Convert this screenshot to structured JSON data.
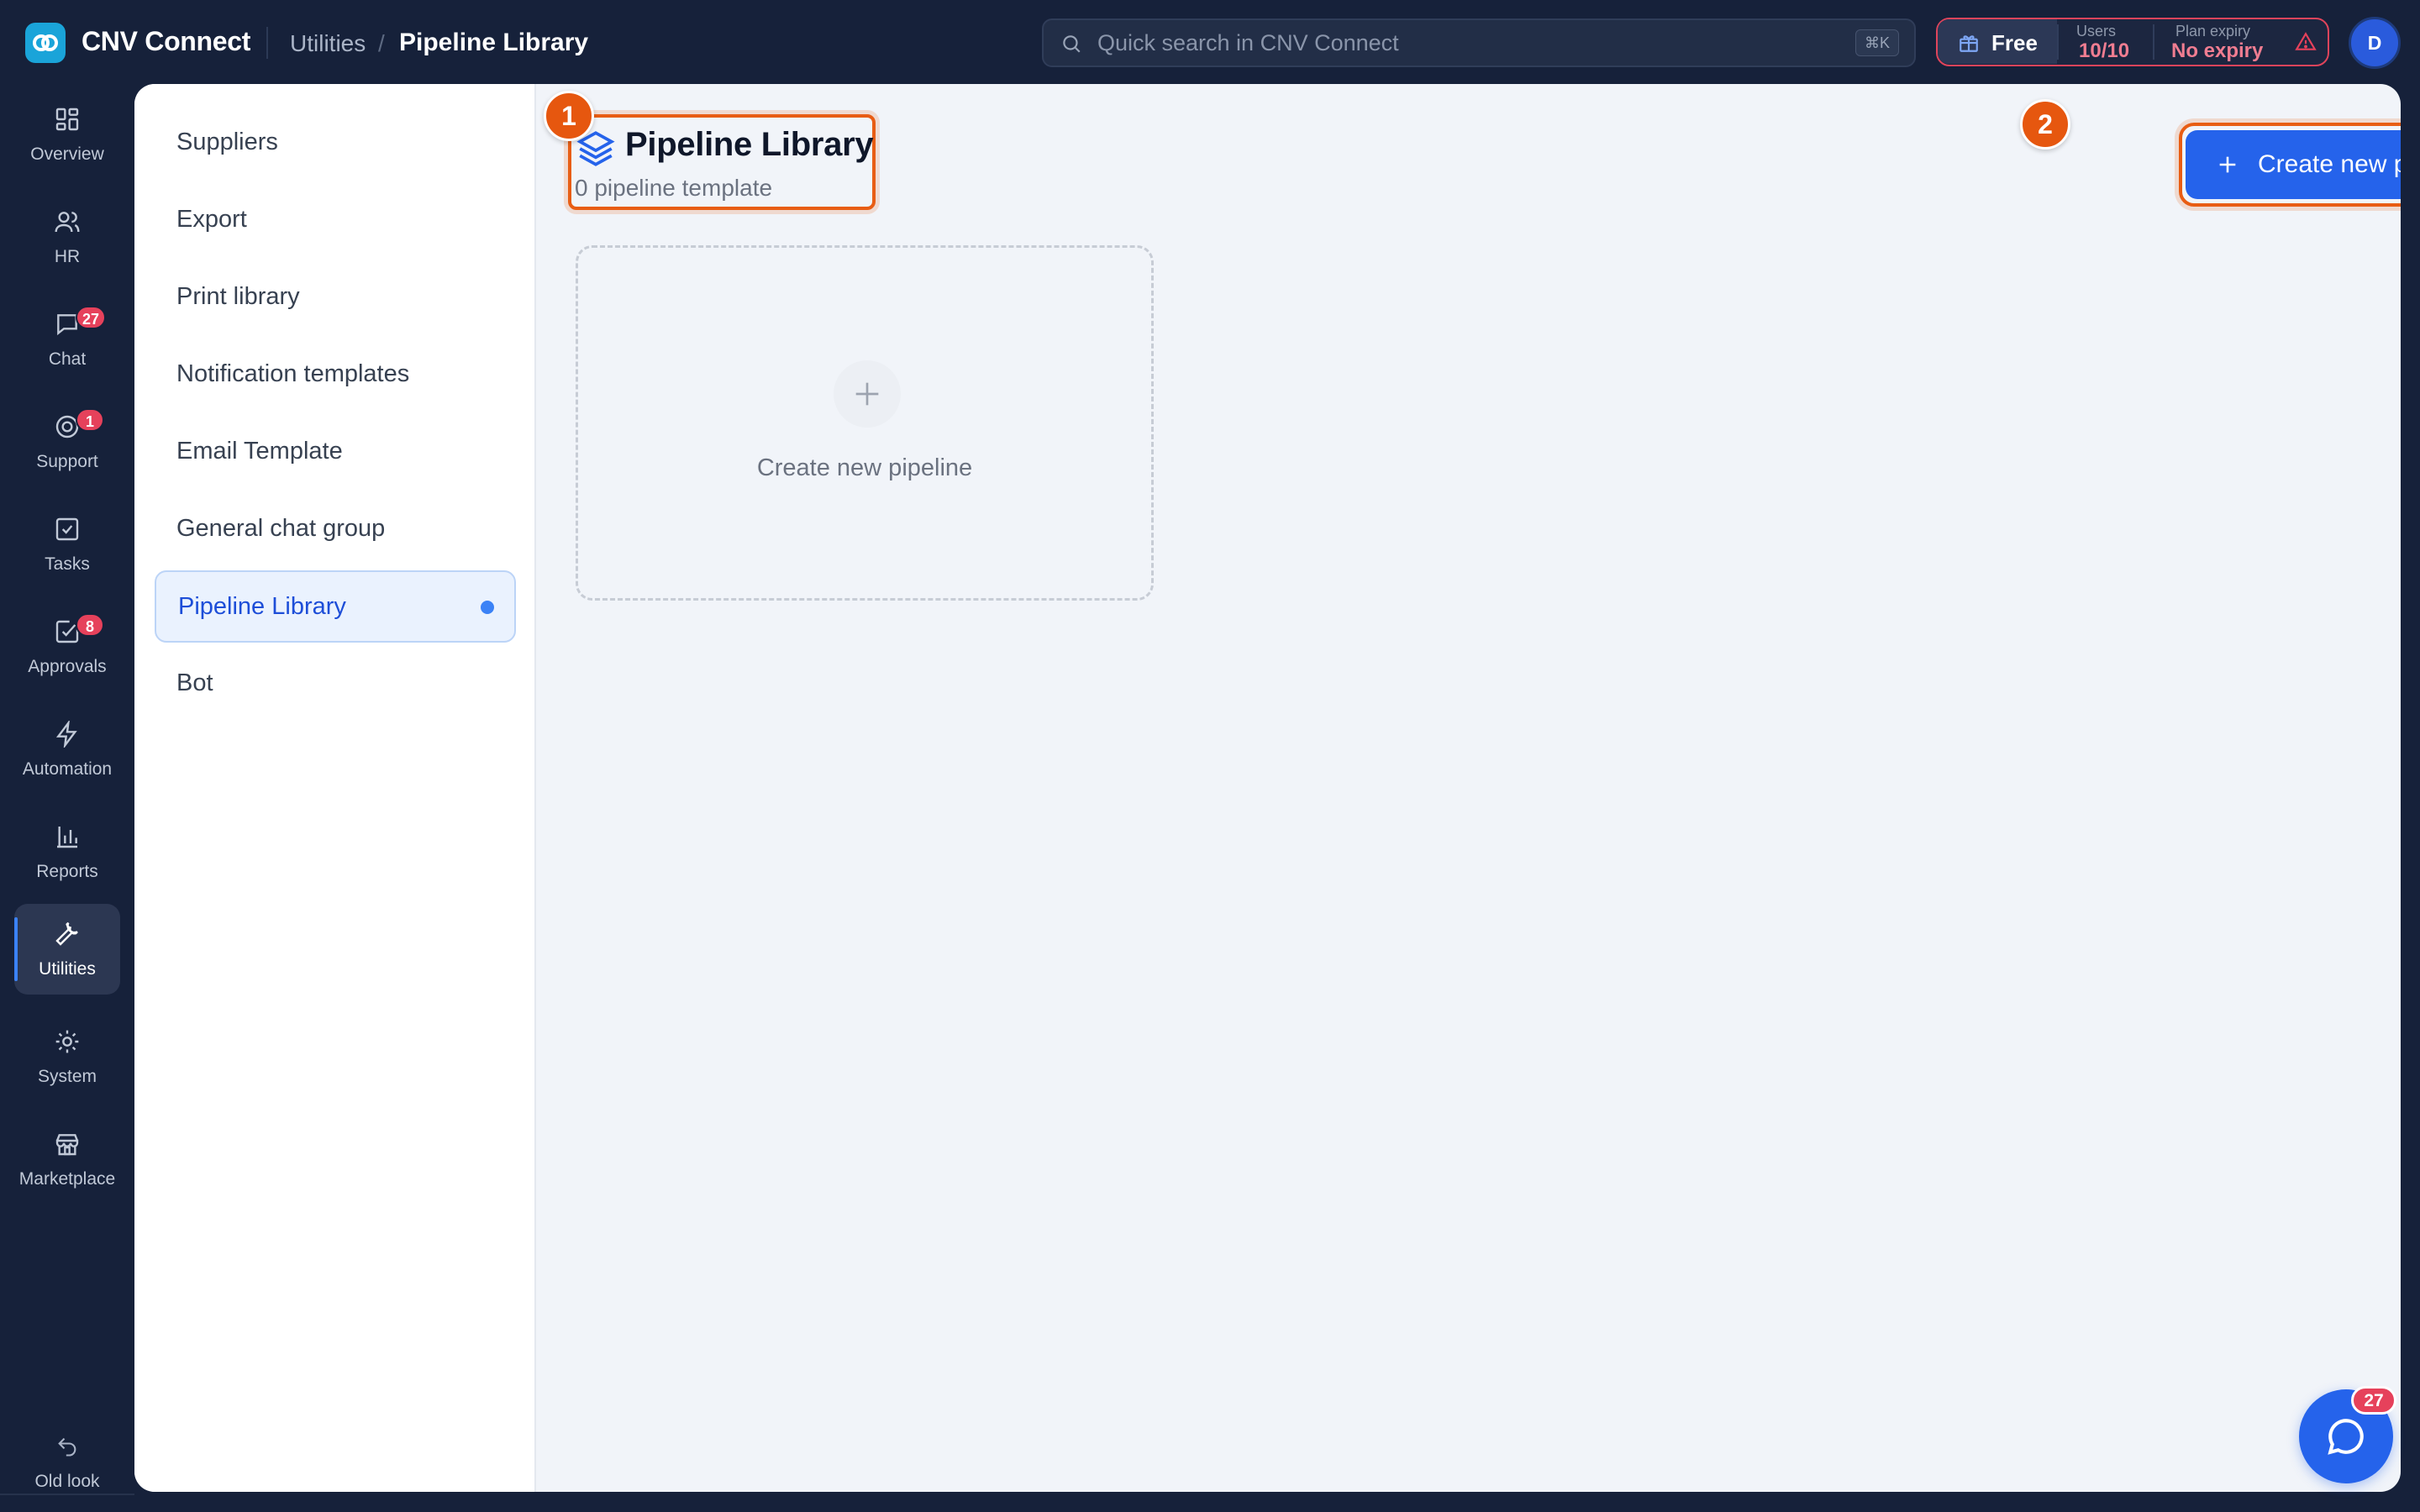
{
  "app": {
    "name": "CNV Connect"
  },
  "breadcrumb": {
    "parent": "Utilities",
    "separator": "/",
    "current": "Pipeline Library"
  },
  "search": {
    "placeholder": "Quick search in CNV Connect",
    "shortcut": "⌘K"
  },
  "plan": {
    "name": "Free",
    "users_label": "Users",
    "users_value": "10/10",
    "expiry_label": "Plan expiry",
    "expiry_value": "No expiry"
  },
  "user": {
    "initial": "D"
  },
  "rail": {
    "items": [
      {
        "label": "Overview",
        "icon": "grid-icon"
      },
      {
        "label": "HR",
        "icon": "users-icon"
      },
      {
        "label": "Chat",
        "icon": "chat-icon",
        "badge": "27"
      },
      {
        "label": "Support",
        "icon": "support-icon",
        "badge": "1"
      },
      {
        "label": "Tasks",
        "icon": "task-check-icon"
      },
      {
        "label": "Approvals",
        "icon": "approval-icon",
        "badge": "8"
      },
      {
        "label": "Automation",
        "icon": "lightning-icon"
      },
      {
        "label": "Reports",
        "icon": "bar-chart-icon"
      },
      {
        "label": "Utilities",
        "icon": "wrench-icon",
        "active": true
      },
      {
        "label": "System",
        "icon": "gear-icon"
      },
      {
        "label": "Marketplace",
        "icon": "store-icon"
      }
    ],
    "old_look": "Old look"
  },
  "subnav": {
    "items": [
      {
        "label": "Suppliers"
      },
      {
        "label": "Export"
      },
      {
        "label": "Print library"
      },
      {
        "label": "Notification templates"
      },
      {
        "label": "Email Template"
      },
      {
        "label": "General chat group"
      },
      {
        "label": "Pipeline Library",
        "active": true
      },
      {
        "label": "Bot"
      }
    ]
  },
  "page": {
    "title": "Pipeline Library",
    "subtitle": "0 pipeline template",
    "create_button": "Create new pipeline",
    "empty_card_label": "Create new pipeline"
  },
  "annotations": {
    "step1": "1",
    "step2": "2"
  },
  "chat_fab": {
    "badge": "27"
  },
  "colors": {
    "sidebar_bg": "#16213a",
    "accent": "#2563eb",
    "highlight": "#e85d13",
    "badge": "#e6415b"
  }
}
